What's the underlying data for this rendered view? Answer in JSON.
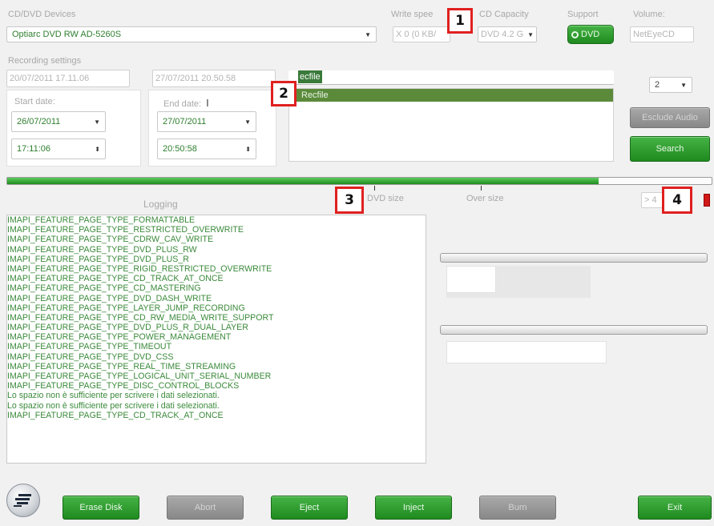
{
  "devices": {
    "label": "CD/DVD Devices",
    "selected": "Optiarc DVD RW AD-5260S"
  },
  "write_speed": {
    "label": "Write spee",
    "value": "X 0 (0 KB/"
  },
  "cd_capacity": {
    "label": "CD Capacity",
    "value": "DVD 4.2 G"
  },
  "support": {
    "label": "Support",
    "value": "DVD"
  },
  "volume": {
    "label": "Volume:",
    "value": "NetEyeCD"
  },
  "recording": {
    "label": "Recording settings",
    "from_text": "20/07/2011  17.11.06",
    "to_text": "27/07/2011  20.50.58",
    "start_label": "Start date:",
    "end_label": "End date:",
    "start_date": "26/07/2011",
    "start_time": "17:11:06",
    "end_date": "27/07/2011",
    "end_time": "20:50:58"
  },
  "recfile": {
    "input_text": "ecfile",
    "items": [
      "Recfile"
    ]
  },
  "count_select": "2",
  "buttons": {
    "exclude_audio": "Esclude Audio",
    "search": "Search",
    "erase": "Erase Disk",
    "abort": "Abort",
    "eject": "Eject",
    "inject": "Inject",
    "burn": "Burn",
    "exit": "Exit"
  },
  "progress": {
    "fill_fraction": 0.84,
    "dvd_size_label": "DVD size",
    "over_size_label": "Over size",
    "readout": "> 4"
  },
  "logging": {
    "title": "Logging",
    "lines": [
      "  IMAPI_FEATURE_PAGE_TYPE_FORMATTABLE",
      "  IMAPI_FEATURE_PAGE_TYPE_RESTRICTED_OVERWRITE",
      "  IMAPI_FEATURE_PAGE_TYPE_CDRW_CAV_WRITE",
      "  IMAPI_FEATURE_PAGE_TYPE_DVD_PLUS_RW",
      "  IMAPI_FEATURE_PAGE_TYPE_DVD_PLUS_R",
      "  IMAPI_FEATURE_PAGE_TYPE_RIGID_RESTRICTED_OVERWRITE",
      "  IMAPI_FEATURE_PAGE_TYPE_CD_TRACK_AT_ONCE",
      "  IMAPI_FEATURE_PAGE_TYPE_CD_MASTERING",
      "  IMAPI_FEATURE_PAGE_TYPE_DVD_DASH_WRITE",
      "  IMAPI_FEATURE_PAGE_TYPE_LAYER_JUMP_RECORDING",
      "  IMAPI_FEATURE_PAGE_TYPE_CD_RW_MEDIA_WRITE_SUPPORT",
      "  IMAPI_FEATURE_PAGE_TYPE_DVD_PLUS_R_DUAL_LAYER",
      "  IMAPI_FEATURE_PAGE_TYPE_POWER_MANAGEMENT",
      "  IMAPI_FEATURE_PAGE_TYPE_TIMEOUT",
      "  IMAPI_FEATURE_PAGE_TYPE_DVD_CSS",
      "  IMAPI_FEATURE_PAGE_TYPE_REAL_TIME_STREAMING",
      "  IMAPI_FEATURE_PAGE_TYPE_LOGICAL_UNIT_SERIAL_NUMBER",
      "  IMAPI_FEATURE_PAGE_TYPE_DISC_CONTROL_BLOCKS",
      "Lo spazio non è sufficiente per scrivere i dati selezionati.",
      "Lo spazio non è sufficiente per scrivere i dati selezionati.",
      "  IMAPI_FEATURE_PAGE_TYPE_CD_TRACK_AT_ONCE"
    ]
  },
  "callouts": [
    "1",
    "2",
    "3",
    "4"
  ],
  "colors": {
    "accent_green": "#2a992a",
    "text_green": "#2f7f2f",
    "callout_red": "#e02020",
    "indicator_red": "#d01818"
  }
}
